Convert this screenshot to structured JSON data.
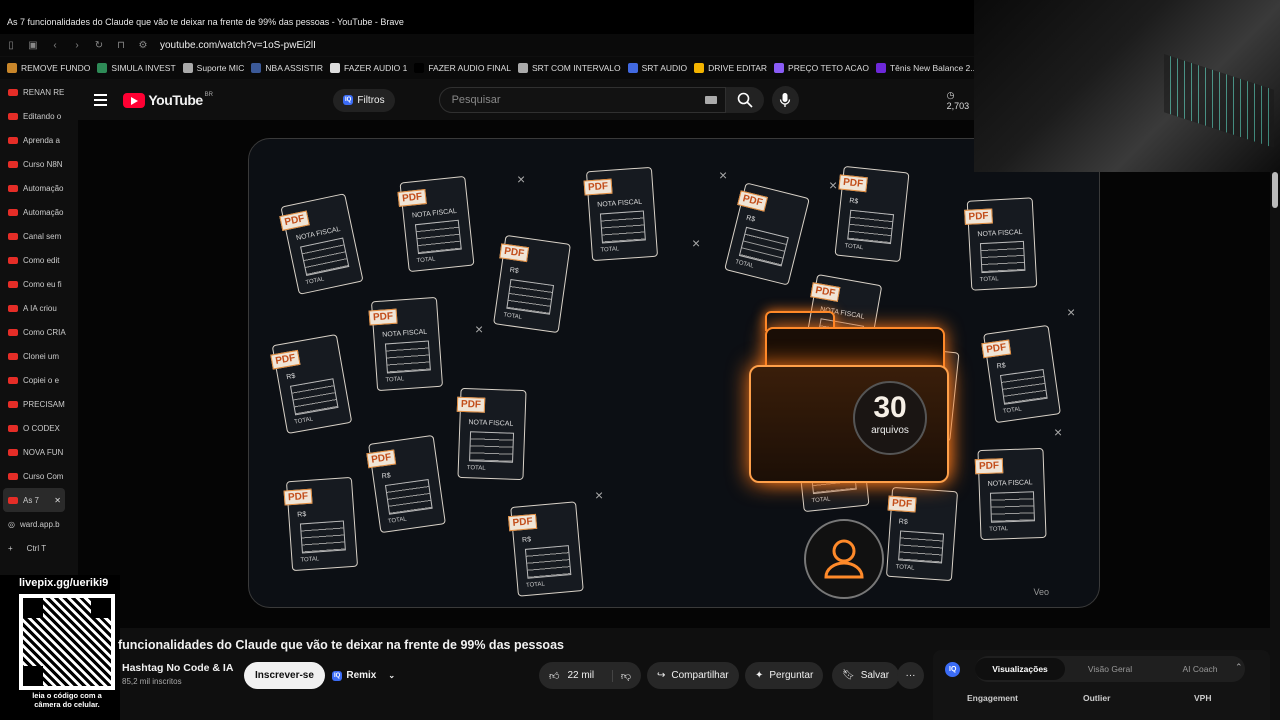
{
  "window": {
    "title": "As 7 funcionalidades do Claude que vão te deixar na frente de 99% das pessoas - YouTube - Brave"
  },
  "browser": {
    "url": "youtube.com/watch?v=1oS-pwEi2lI"
  },
  "bookmarks": [
    {
      "label": "REMOVE FUNDO",
      "color": "#c8862a"
    },
    {
      "label": "SIMULA INVEST",
      "color": "#2e8b57"
    },
    {
      "label": "Suporte MIC",
      "color": "#aaaaaa"
    },
    {
      "label": "NBA ASSISTIR",
      "color": "#3b5998"
    },
    {
      "label": "FAZER AUDIO 1",
      "color": "#dddddd"
    },
    {
      "label": "FAZER AUDIO FINAL",
      "color": "#000000"
    },
    {
      "label": "SRT COM INTERVALO",
      "color": "#aaaaaa"
    },
    {
      "label": "SRT AUDIO",
      "color": "#4169e1"
    },
    {
      "label": "DRIVE EDITAR",
      "color": "#f4b400"
    },
    {
      "label": "PREÇO TETO ACAO",
      "color": "#8a5cf6"
    },
    {
      "label": "Tênis New Balance 2...",
      "color": "#6d28d9"
    }
  ],
  "tabs": [
    {
      "label": "RENAN RE"
    },
    {
      "label": "Editando o"
    },
    {
      "label": "Aprenda a"
    },
    {
      "label": "Curso N8N"
    },
    {
      "label": "Automação"
    },
    {
      "label": "Automação"
    },
    {
      "label": "Canal sem"
    },
    {
      "label": "Como edit"
    },
    {
      "label": "Como eu fi"
    },
    {
      "label": "A IA criou"
    },
    {
      "label": "Como CRIA"
    },
    {
      "label": "Clonei um"
    },
    {
      "label": "Copiei o e"
    },
    {
      "label": "PRECISAM"
    },
    {
      "label": "O CODEX"
    },
    {
      "label": "NOVA FUN"
    },
    {
      "label": "Curso Com"
    }
  ],
  "active_tab": {
    "label": "As 7"
  },
  "extra_tab": {
    "label": "ward.app.b"
  },
  "new_tab": {
    "plus": "+",
    "shortcut": "Ctrl T"
  },
  "youtube": {
    "logo": "YouTube",
    "region": "BR",
    "filters": "Filtros",
    "search_placeholder": "Pesquisar",
    "counter": "2,703"
  },
  "thumbnail": {
    "count": "30",
    "count_label": "arquivos",
    "watermark": "Veo",
    "pdf": "PDF",
    "nota": "NOTA FISCAL",
    "rs": "R$",
    "total": "TOTAL"
  },
  "overlay": {
    "livepix_url": "livepix.gg/ueriki9",
    "qr_caption": "leia o código com a câmera do celular."
  },
  "video": {
    "title": "funcionalidades do Claude que vão te deixar na frente de 99% das pessoas",
    "channel": "Hashtag No Code & IA",
    "subscribers": "85,2 mil inscritos",
    "subscribe": "Inscrever-se",
    "remix": "Remix",
    "likes": "22 mil",
    "share": "Compartilhar",
    "ask": "Perguntar",
    "save": "Salvar"
  },
  "panel": {
    "tabs": [
      "Visualizações",
      "Visão Geral",
      "AI Coach"
    ],
    "columns": [
      "Engagement",
      "Outlier",
      "VPH"
    ]
  }
}
